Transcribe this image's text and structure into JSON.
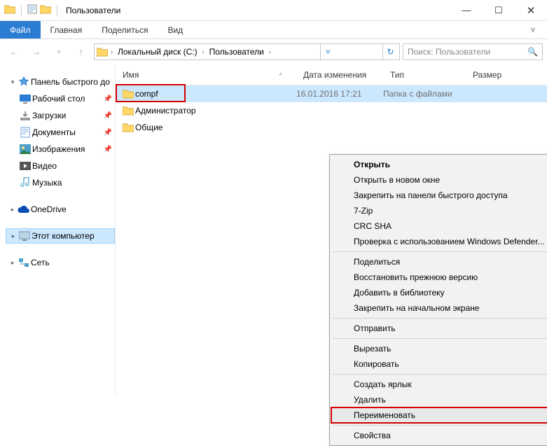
{
  "window": {
    "title": "Пользователи"
  },
  "ribbon": {
    "file": "Файл",
    "tabs": [
      "Главная",
      "Поделиться",
      "Вид"
    ]
  },
  "address": {
    "crumbs": [
      "Локальный диск (C:)",
      "Пользователи"
    ]
  },
  "search": {
    "placeholder": "Поиск: Пользователи"
  },
  "tree": {
    "quick_access": "Панель быстрого до",
    "items": [
      {
        "label": "Рабочий стол",
        "pinned": true,
        "color": "#2b7cd3"
      },
      {
        "label": "Загрузки",
        "pinned": true,
        "color": "#7a7a7a"
      },
      {
        "label": "Документы",
        "pinned": true,
        "color": "#69a1d8"
      },
      {
        "label": "Изображения",
        "pinned": true,
        "color": "#4aa0c8"
      },
      {
        "label": "Видео",
        "pinned": false,
        "color": "#555"
      },
      {
        "label": "Музыка",
        "pinned": false,
        "color": "#4aa0c8"
      }
    ],
    "onedrive": "OneDrive",
    "this_pc": "Этот компьютер",
    "network": "Сеть"
  },
  "columns": {
    "name": "Имя",
    "date": "Дата изменения",
    "type": "Тип",
    "size": "Размер"
  },
  "files": [
    {
      "name": "compf",
      "date": "16.01.2016 17:21",
      "type": "Папка с файлами",
      "selected": true
    },
    {
      "name": "Администратор",
      "date": "",
      "type": ""
    },
    {
      "name": "Общие",
      "date": "",
      "type": ""
    }
  ],
  "context_menu": {
    "items": [
      {
        "label": "Открыть",
        "bold": true
      },
      {
        "label": "Открыть в новом окне"
      },
      {
        "label": "Закрепить на панели быстрого доступа"
      },
      {
        "label": "7-Zip",
        "submenu": true
      },
      {
        "label": "CRC SHA",
        "submenu": true
      },
      {
        "label": "Проверка с использованием Windows Defender..."
      },
      {
        "sep": true
      },
      {
        "label": "Поделиться",
        "submenu": true
      },
      {
        "label": "Восстановить прежнюю версию"
      },
      {
        "label": "Добавить в библиотеку",
        "submenu": true
      },
      {
        "label": "Закрепить на начальном экране"
      },
      {
        "sep": true
      },
      {
        "label": "Отправить",
        "submenu": true
      },
      {
        "sep": true
      },
      {
        "label": "Вырезать"
      },
      {
        "label": "Копировать"
      },
      {
        "sep": true
      },
      {
        "label": "Создать ярлык"
      },
      {
        "label": "Удалить"
      },
      {
        "label": "Переименовать",
        "highlighted": true
      },
      {
        "sep": true
      },
      {
        "label": "Свойства"
      }
    ]
  }
}
